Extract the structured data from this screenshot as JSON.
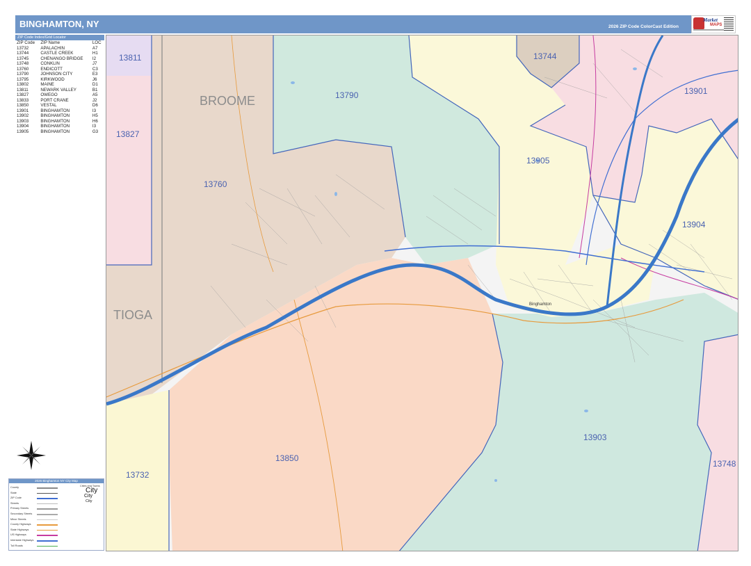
{
  "header": {
    "title": "BINGHAMTON, NY",
    "edition": "2026 ZIP Code ColorCast Edition",
    "logo_text": "Market",
    "logo_maps": "MAPS"
  },
  "index": {
    "title": "ZIP Code Index/Grid Locator",
    "columns": [
      "ZIP Code",
      "ZIP Name",
      "LOC"
    ],
    "rows": [
      [
        "13732",
        "APALACHIN",
        "A7"
      ],
      [
        "13744",
        "CASTLE CREEK",
        "H1"
      ],
      [
        "13745",
        "CHENANGO BRIDGE",
        "I2"
      ],
      [
        "13748",
        "CONKLIN",
        "J7"
      ],
      [
        "13760",
        "ENDICOTT",
        "C3"
      ],
      [
        "13790",
        "JOHNSON CITY",
        "E3"
      ],
      [
        "13795",
        "KIRKWOOD",
        "J6"
      ],
      [
        "13802",
        "MAINE",
        "D1"
      ],
      [
        "13811",
        "NEWARK VALLEY",
        "B1"
      ],
      [
        "13827",
        "OWEGO",
        "A5"
      ],
      [
        "13833",
        "PORT CRANE",
        "J2"
      ],
      [
        "13850",
        "VESTAL",
        "D6"
      ],
      [
        "13901",
        "BINGHAMTON",
        "I3"
      ],
      [
        "13902",
        "BINGHAMTON",
        "H5"
      ],
      [
        "13903",
        "BINGHAMTON",
        "H6"
      ],
      [
        "13904",
        "BINGHAMTON",
        "I3"
      ],
      [
        "13905",
        "BINGHAMTON",
        "G3"
      ]
    ]
  },
  "map": {
    "zip_labels": {
      "z13811": "13811",
      "z13744": "13744",
      "z13790": "13790",
      "z13901": "13901",
      "z13827": "13827",
      "z13905": "13905",
      "z13760": "13760",
      "z13904": "13904",
      "z13903": "13903",
      "z13850": "13850",
      "z13732": "13732",
      "z13748": "13748"
    },
    "county_labels": {
      "broome": "BROOME",
      "tioga": "TIOGA"
    },
    "city_labels": {
      "binghamton": "Binghamton"
    },
    "colors": {
      "z13811": "#e6dcf2",
      "z13744": "#dccfc0",
      "z13790": "#d0e9de",
      "z13901": "#f8dde2",
      "z13827": "#f8dde2",
      "z13905": "#fbf8d9",
      "z13760": "#e8d8cb",
      "z13904": "#fbf8d9",
      "z13903": "#cfe8df",
      "z13850": "#fad9c6",
      "z13732": "#fbf7d3",
      "z13748": "#f8dde2",
      "river": "#3a78c8",
      "zip_line": "#4466bb"
    }
  },
  "legend": {
    "title": "2026 Binghamton NY City Map",
    "rows": [
      "County",
      "State",
      "ZIP Code",
      "Streets",
      "Primary Streets",
      "Secondary Streets",
      "Minor Streets",
      "County Highways",
      "State Highways",
      "US Highways",
      "Interstate Highways",
      "Toll Roads"
    ],
    "cities_title": "Cities and Towns",
    "city_big": "City",
    "city_mid": "City",
    "city_small": "City"
  }
}
